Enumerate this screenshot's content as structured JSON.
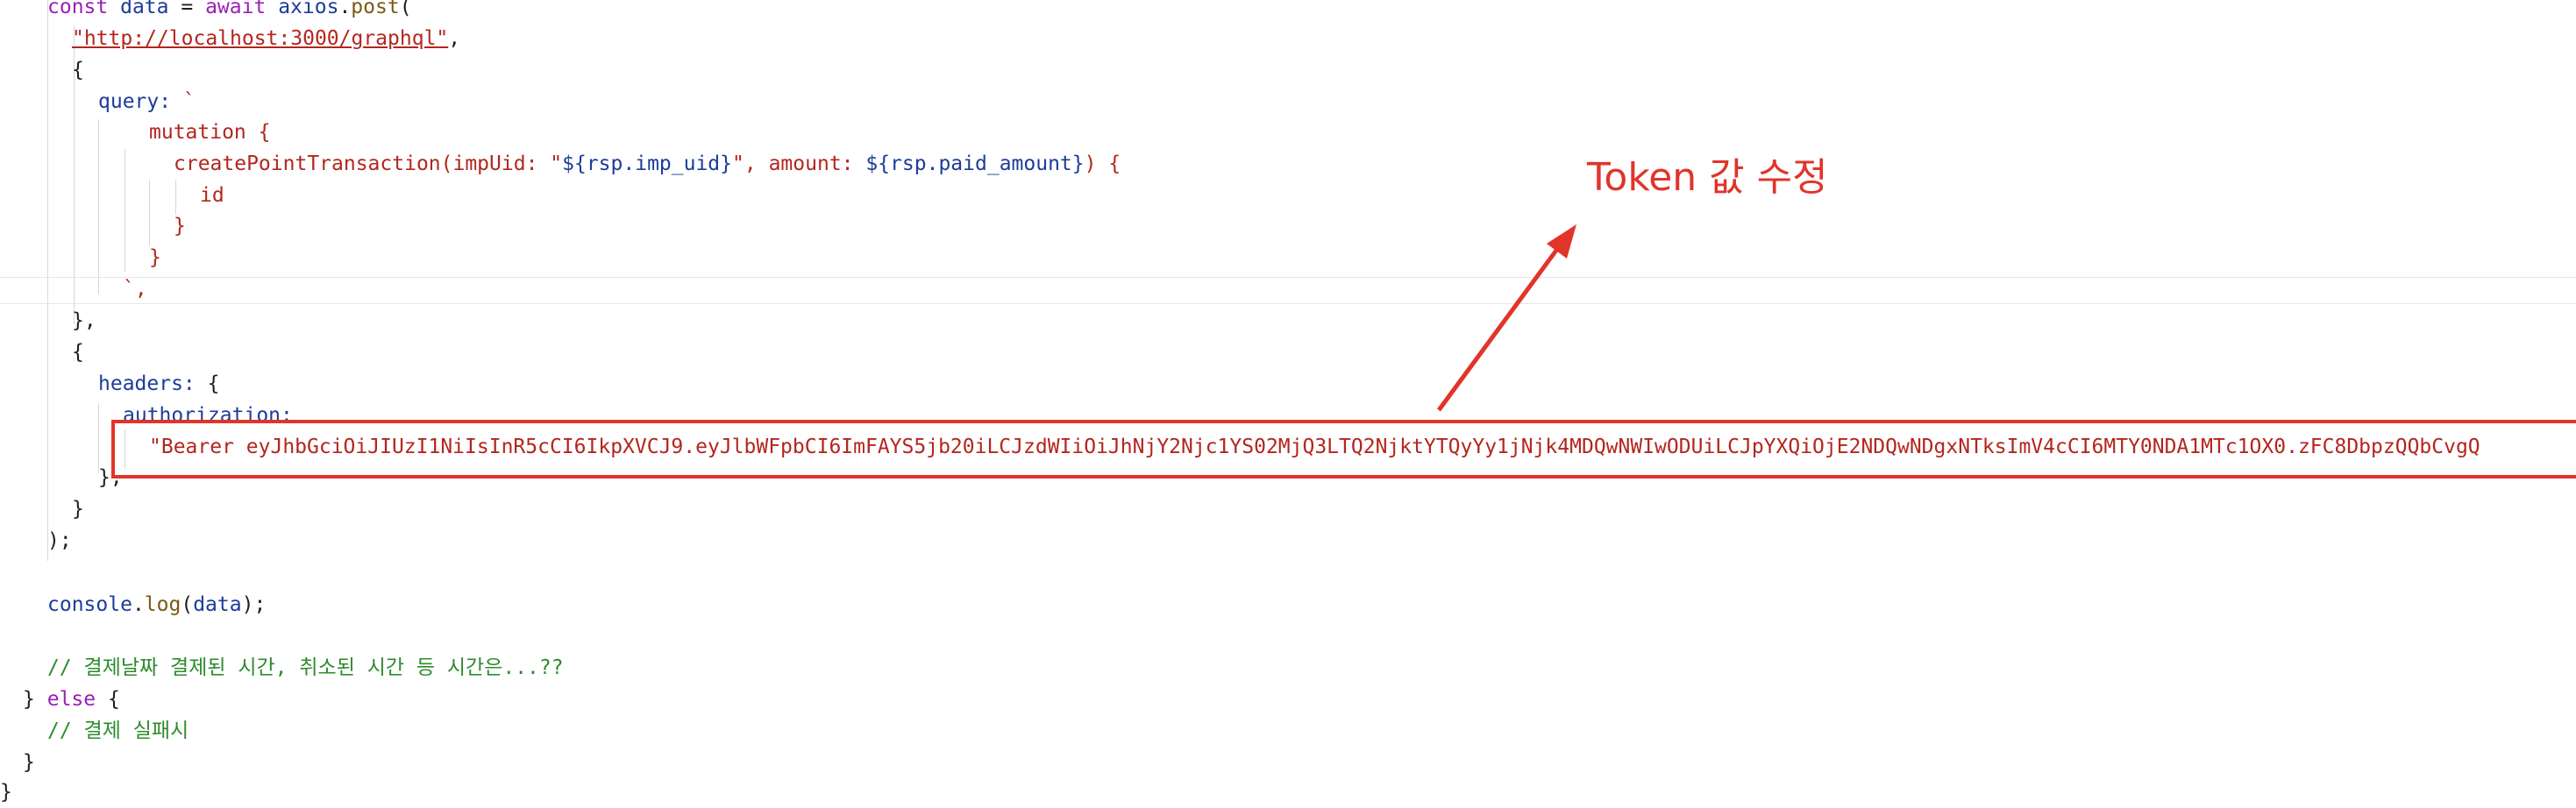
{
  "code": {
    "l1": {
      "kw_const": "const",
      "var_data": "data",
      "op_eq": "=",
      "kw_await": "await",
      "obj_axios": "axios",
      "dot": ".",
      "fn_post": "post",
      "paren": "("
    },
    "l2": {
      "url": "\"http://localhost:3000/graphql\"",
      "comma": ","
    },
    "l3": {
      "brace": "{"
    },
    "l4": {
      "prop_query": "query:",
      "backtick": "`"
    },
    "l5": {
      "mutation": "mutation {"
    },
    "l6": {
      "fn_name": "createPointTransaction(impUid:",
      "str_open": "\"",
      "interp1": "${rsp.imp_uid}",
      "str_close": "\",",
      "arg_amount": "amount:",
      "interp2": "${rsp.paid_amount}",
      "tail": ") {"
    },
    "l7": {
      "field_id": "id"
    },
    "l8": {
      "brace": "}"
    },
    "l9": {
      "brace": "}"
    },
    "l10": {
      "backtick_comma": "`,"
    },
    "l11": {
      "text": "},"
    },
    "l12": {
      "text": "{"
    },
    "l13": {
      "prop": "headers:",
      "brace": "{"
    },
    "l14": {
      "prop": "authorization:"
    },
    "l15": {
      "token": "\"Bearer eyJhbGciOiJIUzI1NiIsInR5cCI6IkpXVCJ9.eyJlbWFpbCI6ImFAYS5jb20iLCJzdWIiOiJhNjY2Njc1YS02MjQ3LTQ2NjktYTQyYy1jNjk4MDQwNWIwODUiLCJpYXQiOjE2NDQwNDgxNTksImV4cCI6MTY0NDA1MTc1OX0.zFC8DbpzQQbCvgQ"
    },
    "l16": {
      "text": "},"
    },
    "l17": {
      "text": "}"
    },
    "l18": {
      "text": ");"
    },
    "l20": {
      "obj": "console",
      "dot": ".",
      "fn": "log",
      "open": "(",
      "arg": "data",
      "close": ");"
    },
    "l22": {
      "comment": "// 결제날짜 결제된 시간, 취소된 시간 등 시간은...??"
    },
    "l23": {
      "open": "}",
      "kw_else": "else",
      "brace": "{"
    },
    "l24": {
      "comment": "// 결제 실패시"
    },
    "l25": {
      "text": "}"
    },
    "l26": {
      "text": "}"
    }
  },
  "annotation": {
    "label": "Token 값 수정",
    "color": "#e1342a"
  }
}
